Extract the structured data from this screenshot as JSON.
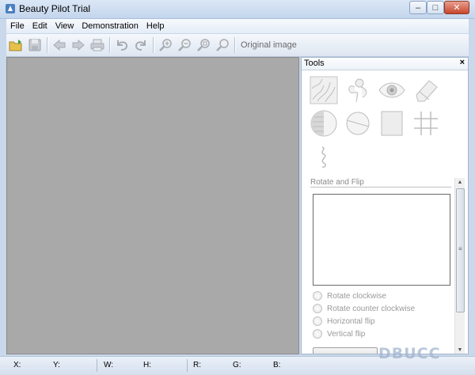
{
  "window": {
    "title": "Beauty Pilot Trial",
    "min_glyph": "–",
    "max_glyph": "□",
    "close_glyph": "✕"
  },
  "menu": [
    {
      "label": "File"
    },
    {
      "label": "Edit"
    },
    {
      "label": "View"
    },
    {
      "label": "Demonstration"
    },
    {
      "label": "Help"
    }
  ],
  "toolbar": {
    "original_image_label": "Original image"
  },
  "tools_panel": {
    "title": "Tools",
    "close_glyph": "×",
    "section_title": "Rotate and Flip",
    "options": [
      {
        "label": "Rotate clockwise"
      },
      {
        "label": "Rotate counter clockwise"
      },
      {
        "label": "Horizontal flip"
      },
      {
        "label": "Vertical flip"
      }
    ],
    "scroll_up": "▲",
    "scroll_down": "▼",
    "grip": "≡"
  },
  "status": [
    {
      "label": "X:"
    },
    {
      "label": "Y:"
    },
    {
      "label": "W:"
    },
    {
      "label": "H:"
    },
    {
      "label": "R:"
    },
    {
      "label": "G:"
    },
    {
      "label": "B:"
    }
  ],
  "watermark": "DBUCC",
  "colors": {
    "titlebar": "#c3d5ec",
    "canvas": "#a9a9a9",
    "disabled_text": "#9a9a9a"
  }
}
